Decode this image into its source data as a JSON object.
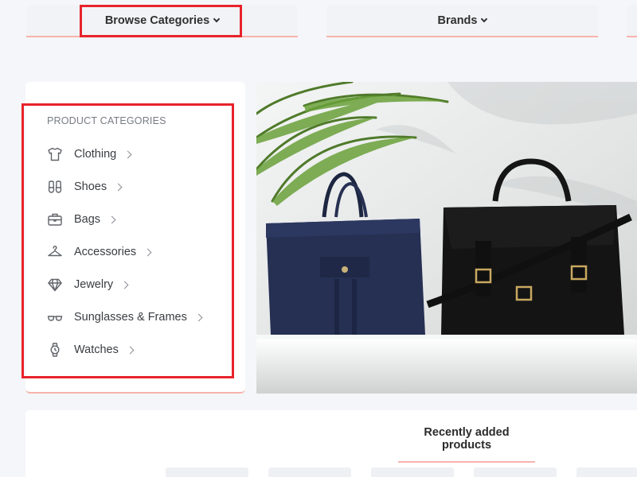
{
  "nav": {
    "browse_label": "Browse Categories",
    "brands_label": "Brands"
  },
  "sidebar": {
    "heading": "PRODUCT CATEGORIES",
    "items": [
      {
        "label": "Clothing",
        "icon": "shirt-icon"
      },
      {
        "label": "Shoes",
        "icon": "shoes-icon"
      },
      {
        "label": "Bags",
        "icon": "bag-icon"
      },
      {
        "label": "Accessories",
        "icon": "hanger-icon"
      },
      {
        "label": "Jewelry",
        "icon": "diamond-icon"
      },
      {
        "label": "Sunglasses & Frames",
        "icon": "sunglasses-icon"
      },
      {
        "label": "Watches",
        "icon": "watch-icon"
      }
    ]
  },
  "hero": {
    "image": "handbags-banner"
  },
  "recent": {
    "title": "Recently added products"
  },
  "colors": {
    "accent": "#f7b3ad",
    "highlight": "#e8232b",
    "background": "#f5f6f9"
  }
}
